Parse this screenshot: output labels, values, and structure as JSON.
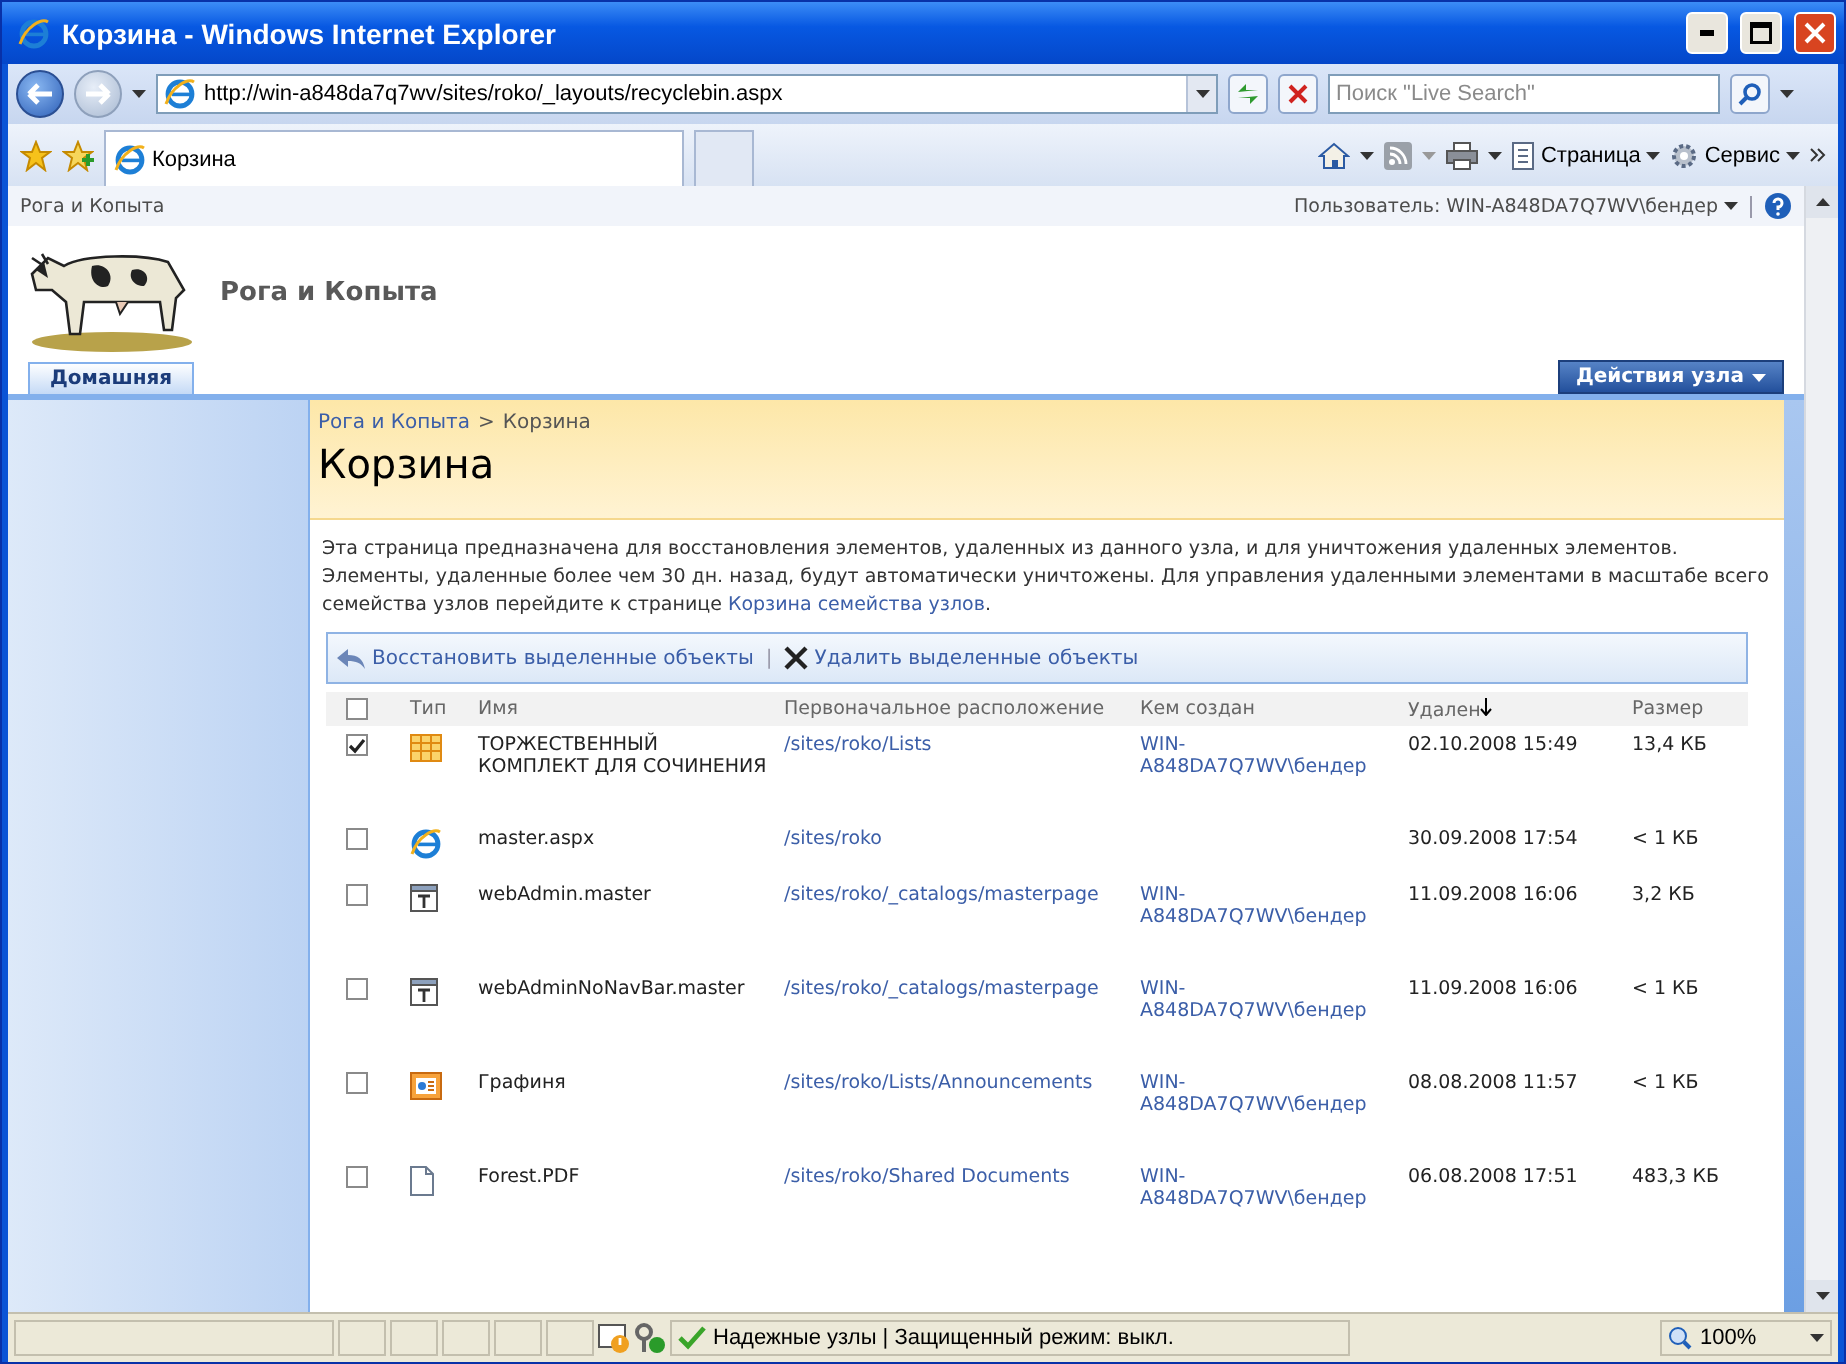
{
  "window": {
    "title": "Корзина - Windows Internet Explorer"
  },
  "address_bar": {
    "url": "http://win-a848da7q7wv/sites/roko/_layouts/recyclebin.aspx"
  },
  "search": {
    "placeholder": "Поиск \"Live Search\""
  },
  "browser_tabs": [
    {
      "label": "Корзина",
      "selected": true
    }
  ],
  "command_bar": {
    "page_menu": "Страница",
    "tools_menu": "Сервис"
  },
  "site": {
    "breadcrumb_top": "Рога и Копыта",
    "user": "Пользователь: WIN-A848DA7Q7WV\\бендер",
    "title": "Рога и Копыта",
    "tabs": [
      {
        "label": "Домашняя",
        "selected": true
      }
    ],
    "site_actions": "Действия узла"
  },
  "page": {
    "breadcrumb": [
      {
        "label": "Рога и Копыта",
        "kind": "link"
      },
      {
        "label": ">",
        "kind": "separator"
      },
      {
        "label": "Корзина",
        "kind": "current"
      }
    ],
    "title": "Корзина",
    "description": "Эта страница предназначена для восстановления элементов, удаленных из данного узла, и для уничтожения удаленных элементов. Элементы, удаленные более чем 30 дн. назад, будут автоматически уничтожены. Для управления удаленными элементами в масштабе всего семейства узлов перейдите к странице ",
    "description_link": "Корзина семейства узлов",
    "description_end": ".",
    "toolbar": {
      "restore": "Восстановить выделенные объекты",
      "separator": "|",
      "delete": "Удалить выделенные объекты"
    }
  },
  "table": {
    "select_all_checked": false,
    "columns": [
      "Тип",
      "Имя",
      "Первоначальное расположение",
      "Кем создан",
      "Удален",
      "Размер"
    ],
    "rows": [
      {
        "checked": true,
        "kind": "list",
        "name": "ТОРЖЕСТВЕННЫЙ КОМПЛЕКТ ДЛЯ СОЧИНЕНИЯ",
        "location": "/sites/roko/Lists",
        "created_by": "WIN-A848DA7Q7WV\\бендер",
        "deleted": "02.10.2008 15:49",
        "size": "13,4 КБ"
      },
      {
        "checked": false,
        "kind": "page",
        "name": "master.aspx",
        "location": "/sites/roko",
        "deleted": "30.09.2008 17:54",
        "size": "< 1 КБ"
      },
      {
        "checked": false,
        "kind": "master",
        "name": "webAdmin.master",
        "location": "/sites/roko/_catalogs/masterpage",
        "created_by": "WIN-A848DA7Q7WV\\бендер",
        "deleted": "11.09.2008 16:06",
        "size": "3,2 КБ"
      },
      {
        "checked": false,
        "kind": "master",
        "name": "webAdminNoNavBar.master",
        "location": "/sites/roko/_catalogs/masterpage",
        "created_by": "WIN-A848DA7Q7WV\\бендер",
        "deleted": "11.09.2008 16:06",
        "size": "< 1 КБ"
      },
      {
        "checked": false,
        "kind": "announcement",
        "name": "Графиня",
        "location": "/sites/roko/Lists/Announcements",
        "created_by": "WIN-A848DA7Q7WV\\бендер",
        "deleted": "08.08.2008 11:57",
        "size": "< 1 КБ"
      },
      {
        "checked": false,
        "kind": "document",
        "name": "Forest.PDF",
        "location": "/sites/roko/Shared Documents",
        "created_by": "WIN-A848DA7Q7WV\\бендер",
        "deleted": "06.08.2008 17:51",
        "size": "483,3 КБ"
      }
    ]
  },
  "status_bar": {
    "zone": "Надежные узлы | Защищенный режим: выкл.",
    "zoom": "100%"
  }
}
